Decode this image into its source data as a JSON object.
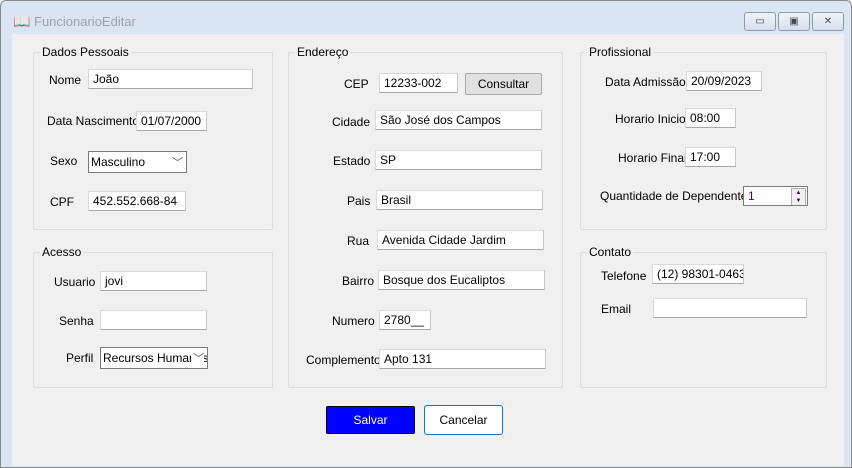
{
  "window": {
    "title": "FuncionarioEditar",
    "minimize": "▭",
    "maximize": "▣",
    "close": "✕"
  },
  "dados_pessoais": {
    "legend": "Dados Pessoais",
    "nome_label": "Nome",
    "nome": "João",
    "nasc_label": "Data Nascimento",
    "nasc": "01/07/2000",
    "sexo_label": "Sexo",
    "sexo": "Masculino",
    "cpf_label": "CPF",
    "cpf": "452.552.668-84"
  },
  "acesso": {
    "legend": "Acesso",
    "usuario_label": "Usuario",
    "usuario": "jovi",
    "senha_label": "Senha",
    "senha": "",
    "perfil_label": "Perfil",
    "perfil": "Recursos Humanos"
  },
  "endereco": {
    "legend": "Endereço",
    "cep_label": "CEP",
    "cep": "12233-002",
    "consultar": "Consultar",
    "cidade_label": "Cidade",
    "cidade": "São José dos Campos",
    "estado_label": "Estado",
    "estado": "SP",
    "pais_label": "Pais",
    "pais": "Brasil",
    "rua_label": "Rua",
    "rua": "Avenida Cidade Jardim",
    "bairro_label": "Bairro",
    "bairro": "Bosque dos Eucaliptos",
    "numero_label": "Numero",
    "numero": "2780__",
    "complemento_label": "Complemento",
    "complemento": "Apto 131"
  },
  "profissional": {
    "legend": "Profissional",
    "admissao_label": "Data Admissão",
    "admissao": "20/09/2023",
    "inicio_label": "Horario Inicio",
    "inicio": "08:00",
    "final_label": "Horario Final",
    "final": "17:00",
    "dependentes_label": "Quantidade de Dependente",
    "dependentes": "1"
  },
  "contato": {
    "legend": "Contato",
    "telefone_label": "Telefone",
    "telefone": "(12) 98301-0463",
    "email_label": "Email",
    "email": ""
  },
  "actions": {
    "salvar": "Salvar",
    "cancelar": "Cancelar",
    "accent": "#0000ff"
  }
}
